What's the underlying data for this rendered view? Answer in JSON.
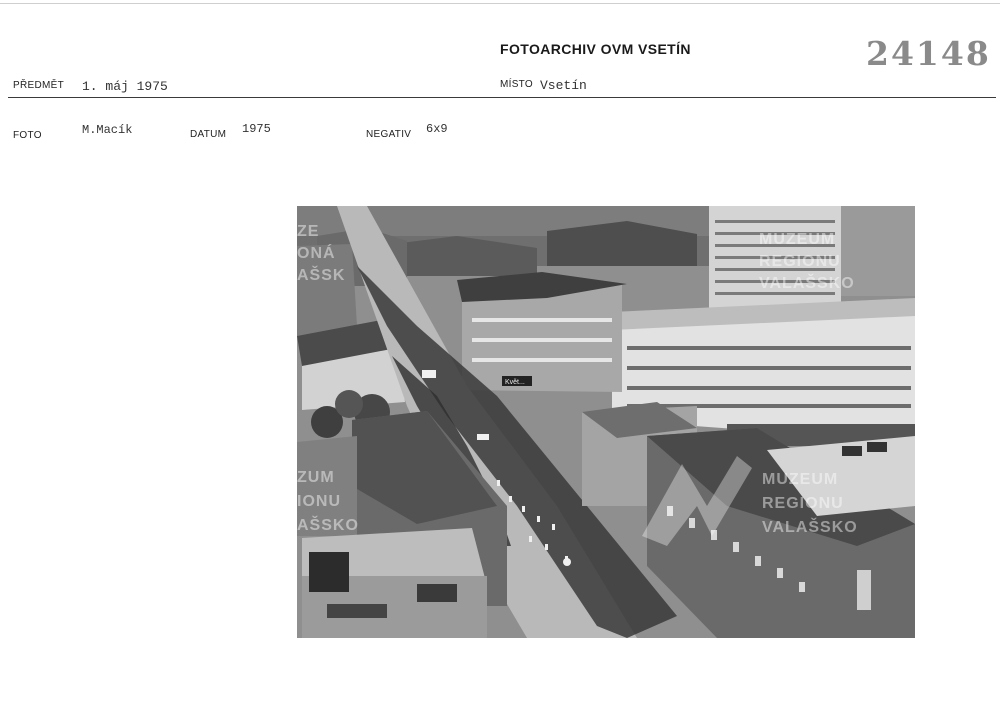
{
  "header": {
    "archive_title": "FOTOARCHIV OVM VSETÍN",
    "inventory_number": "24148"
  },
  "fields": {
    "predmet_label": "PŘEDMĚT",
    "predmet_value": "1. máj 1975",
    "misto_label": "MÍSTO",
    "misto_value": "Vsetín",
    "foto_label": "FOTO",
    "foto_value": "M.Macík",
    "datum_label": "DATUM",
    "datum_value": "1975",
    "negativ_label": "NEGATIV",
    "negativ_value": "6x9"
  },
  "photo": {
    "watermark_left": [
      "ZE",
      "ONÁ",
      "AŠSK"
    ],
    "watermark_top_right": [
      "MUZEUM",
      "REGIONU",
      "VALAŠSKO"
    ],
    "watermark_left_lower": [
      "ZUM",
      "IONU",
      "AŠSKO"
    ],
    "watermark_center": [
      "MUZEUM",
      "REGIONU",
      "VALAŠSKO"
    ],
    "shop_sign": "Květ..."
  }
}
